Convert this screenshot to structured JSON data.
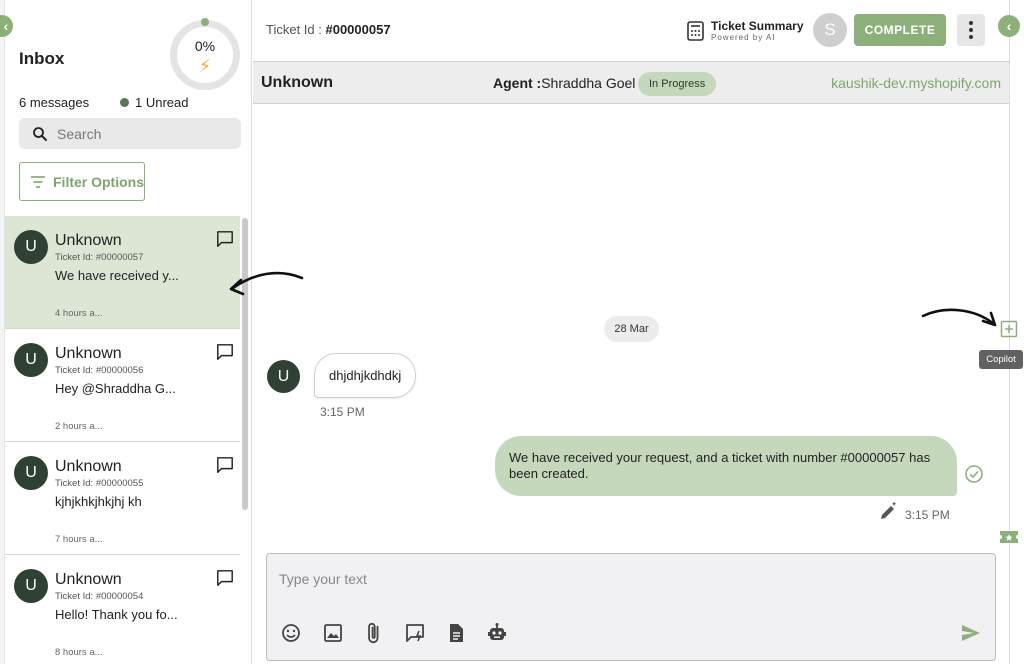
{
  "inbox": {
    "title": "Inbox",
    "progress_label": "0%",
    "progress_fraction": 0,
    "message_count": "6 messages",
    "unread_count": "1 Unread",
    "search_placeholder": "Search",
    "filter_label": "Filter Options"
  },
  "conversations": [
    {
      "name": "Unknown",
      "ticket": "Ticket Id: #00000057",
      "preview": "We have received y...",
      "time": "4 hours a...",
      "active": true
    },
    {
      "name": "Unknown",
      "ticket": "Ticket Id: #00000056",
      "preview": "Hey @Shraddha G...",
      "time": "2 hours a...",
      "active": false
    },
    {
      "name": "Unknown",
      "ticket": "Ticket Id: #00000055",
      "preview": "kjhjkhkjhkjhj kh",
      "time": "7 hours a...",
      "active": false
    },
    {
      "name": "Unknown",
      "ticket": "Ticket Id: #00000054",
      "preview": "Hello! Thank you fo...",
      "time": "8 hours a...",
      "active": false
    }
  ],
  "header": {
    "ticket_label": "Ticket Id : ",
    "ticket_id": "#00000057",
    "summary_title": "Ticket Summary",
    "summary_sub": "Powered by AI",
    "user_initial": "S",
    "complete_label": "COMPLETE"
  },
  "info": {
    "customer": "Unknown",
    "agent_label": "Agent :",
    "agent_name": "Shraddha Goel",
    "status": "In Progress",
    "store": "kaushik-dev.myshopify.com"
  },
  "chat": {
    "date": "28 Mar",
    "incoming_initial": "U",
    "incoming_text": "dhjdhjkdhdkj",
    "incoming_time": "3:15 PM",
    "outgoing_text": "We have received your request, and a ticket with number #00000057 has been created.",
    "outgoing_time": "3:15 PM"
  },
  "composer": {
    "placeholder": "Type your text"
  },
  "rail": {
    "copilot_label": "Copilot"
  },
  "colors": {
    "accent": "#8db07a",
    "accent_light": "#c5d8bb",
    "active_row": "#dde6d5",
    "avatar": "#2f4034"
  }
}
